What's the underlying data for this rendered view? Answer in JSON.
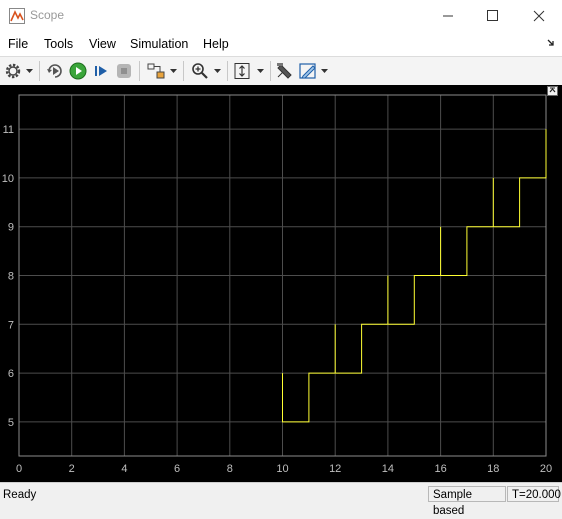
{
  "window": {
    "title": "Scope"
  },
  "menu": [
    "File",
    "Tools",
    "View",
    "Simulation",
    "Help"
  ],
  "toolbar": {
    "icons": [
      "gear-icon",
      "step-back-icon",
      "run-icon",
      "step-forward-icon",
      "stop-icon",
      "signal-selector-icon",
      "zoom-icon",
      "autoscale-icon",
      "highlight-icon",
      "style-icon"
    ]
  },
  "status": {
    "left": "Ready",
    "mode": "Sample based",
    "time": "T=20.000"
  },
  "chart_data": {
    "type": "line",
    "title": "",
    "xlabel": "",
    "ylabel": "",
    "xlim": [
      0,
      20
    ],
    "ylim": [
      4.3,
      11.7
    ],
    "xticks": [
      "0",
      "2",
      "4",
      "6",
      "8",
      "10",
      "12",
      "14",
      "16",
      "18",
      "20"
    ],
    "yticks": [
      "5",
      "6",
      "7",
      "8",
      "9",
      "10",
      "11"
    ],
    "grid": true,
    "background": "#000000",
    "grid_color": "#4d4d4d",
    "tick_label_color": "#bfbfbf",
    "series": [
      {
        "color": "#ffff33",
        "x": [
          10,
          10,
          11,
          11,
          12,
          12,
          12,
          13,
          13,
          14,
          14,
          14,
          15,
          15,
          16,
          16,
          16,
          17,
          17,
          18,
          18,
          18,
          19,
          19,
          20,
          20
        ],
        "y": [
          6,
          5,
          5,
          6,
          6,
          7,
          6,
          6,
          7,
          7,
          8,
          7,
          7,
          8,
          8,
          9,
          8,
          8,
          9,
          9,
          10,
          9,
          9,
          10,
          10,
          11
        ]
      }
    ]
  }
}
